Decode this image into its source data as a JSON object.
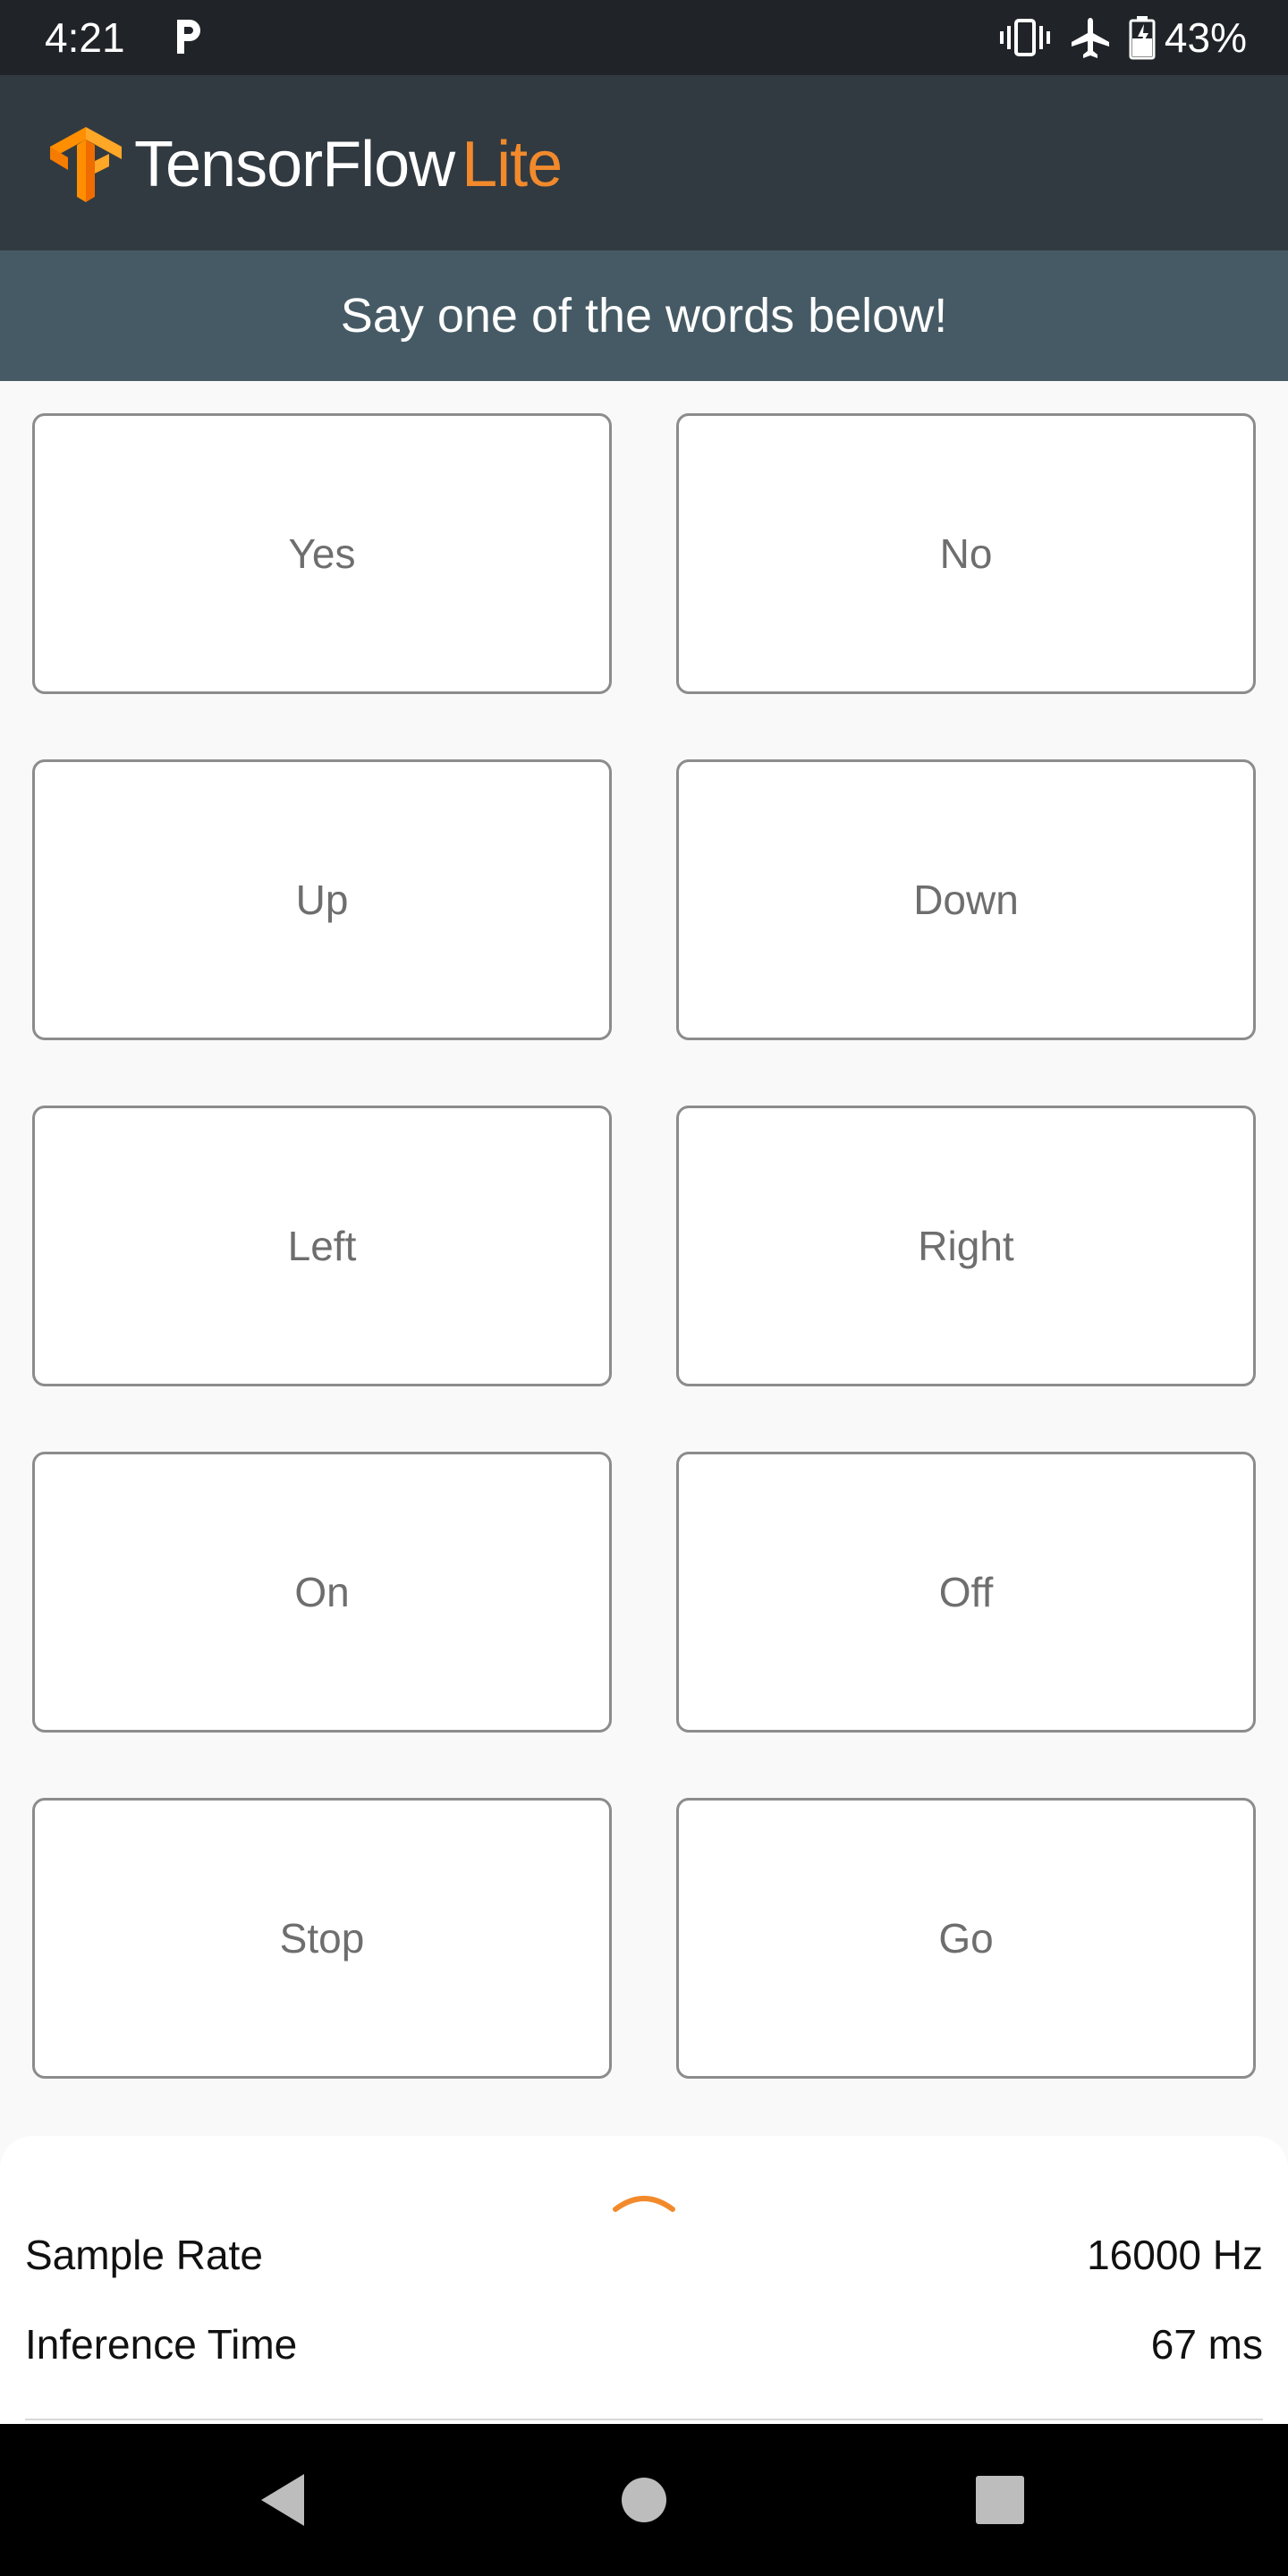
{
  "status_bar": {
    "time": "4:21",
    "battery_percent": "43%",
    "icons": [
      "parking-icon",
      "vibrate-icon",
      "airplane-icon",
      "battery-icon"
    ]
  },
  "app_bar": {
    "logo_main": "TensorFlow",
    "logo_suffix": "Lite",
    "brand_color": "#f28a2c"
  },
  "banner": {
    "text": "Say one of the words below!"
  },
  "words": [
    "Yes",
    "No",
    "Up",
    "Down",
    "Left",
    "Right",
    "On",
    "Off",
    "Stop",
    "Go"
  ],
  "bottom_sheet": {
    "sample_rate_label": "Sample Rate",
    "sample_rate_value": "16000 Hz",
    "inference_time_label": "Inference Time",
    "inference_time_value": "67 ms"
  },
  "nav_bar": {
    "buttons": [
      "back-icon",
      "home-icon",
      "recents-icon"
    ]
  }
}
